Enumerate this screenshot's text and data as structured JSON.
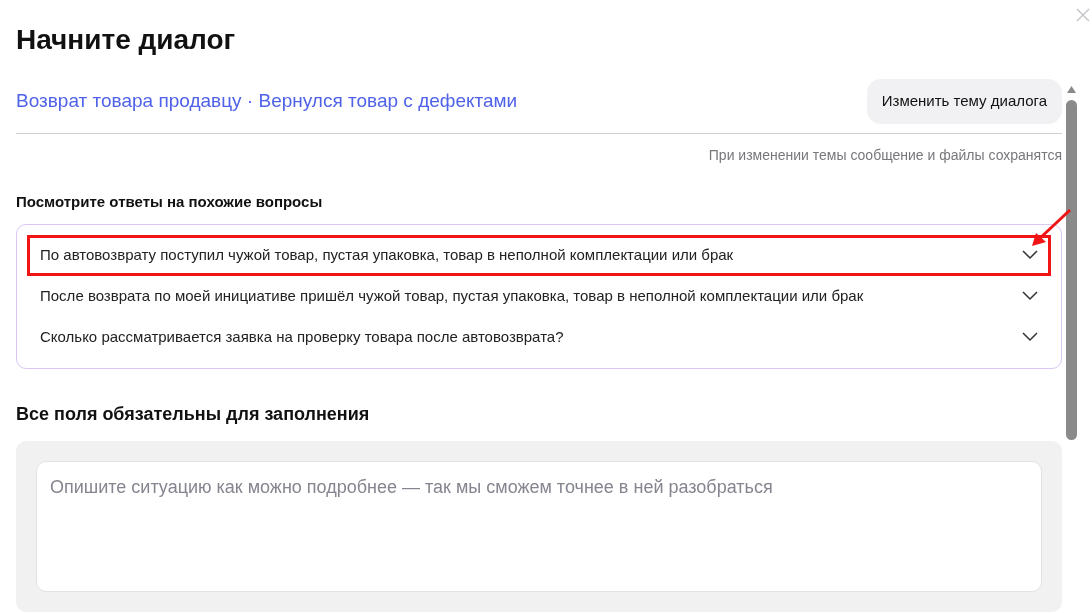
{
  "dialog": {
    "title": "Начните диалог"
  },
  "topic": {
    "path": "Возврат товара продавцу · Вернулся товар с дефектами",
    "change_button": "Изменить тему диалога",
    "note": "При изменении темы сообщение и файлы сохранятся"
  },
  "faq": {
    "heading": "Посмотрите ответы на похожие вопросы",
    "items": [
      {
        "question": "По автовозврату поступил чужой товар, пустая упаковка, товар в неполной комплектации или брак",
        "expanded": false,
        "highlighted": true
      },
      {
        "question": "После возврата по моей инициативе пришёл чужой товар, пустая упаковка, товар в неполной комплектации или брак",
        "expanded": false,
        "highlighted": false
      },
      {
        "question": "Сколько рассматривается заявка на проверку товара после автовозврата?",
        "expanded": false,
        "highlighted": false
      }
    ]
  },
  "form": {
    "heading": "Все поля обязательны для заполнения",
    "description": {
      "placeholder": "Опишите ситуацию как можно подробнее — так мы сможем точнее в ней разобраться"
    }
  }
}
